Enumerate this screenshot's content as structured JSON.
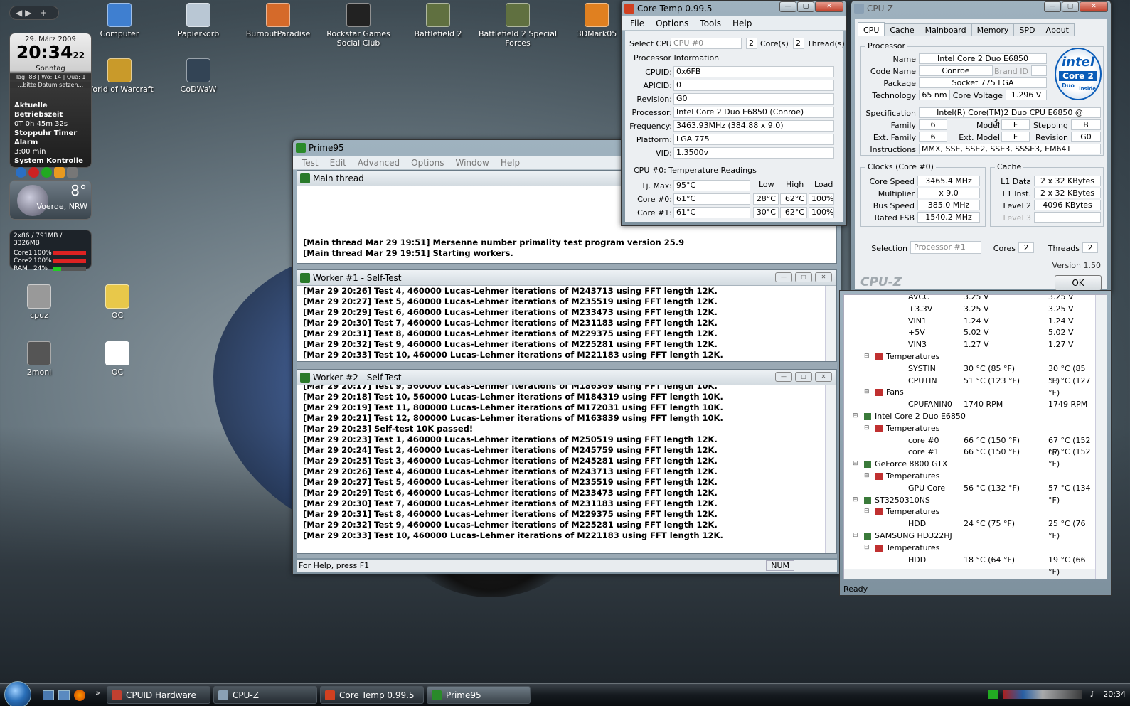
{
  "desktop": {
    "icons": [
      {
        "label": "Computer",
        "color": "#3f7fd0"
      },
      {
        "label": "Papierkorb",
        "color": "#b9c7d4"
      },
      {
        "label": "BurnoutParadise",
        "color": "#d56a2a"
      },
      {
        "label": "Rockstar Games Social Club",
        "color": "#222222"
      },
      {
        "label": "Battlefield 2",
        "color": "#607040"
      },
      {
        "label": "Battlefield 2 Special Forces",
        "color": "#607040"
      },
      {
        "label": "3DMark05",
        "color": "#e08020"
      },
      {
        "label": "World of Warcraft",
        "color": "#c99a2a"
      },
      {
        "label": "CoDWaW",
        "color": "#334455"
      },
      {
        "label": "cpuz",
        "color": "#999999"
      },
      {
        "label": "OC",
        "color": "#e8c84a"
      },
      {
        "label": "2moni",
        "color": "#555555"
      },
      {
        "label": "OC",
        "color": "#ffffff"
      }
    ]
  },
  "gadgets": {
    "clock": {
      "date": "29. März 2009",
      "time": "20:34",
      "seconds": "22",
      "day": "Sonntag",
      "info": "Tag: 88 | Wo: 14 | Qua: 1",
      "note": "...bitte Datum setzen...",
      "uptime_label": "Aktuelle Betriebszeit",
      "uptime": "0T 0h 45m 32s",
      "timer_label": "Stoppuhr Timer Alarm",
      "timer": "3:00 min",
      "control_label": "System Kontrolle"
    },
    "weather": {
      "temp": "8°",
      "location": "Voerde, NRW"
    },
    "meter": {
      "header": "2x86 / 791MB / 3326MB",
      "rows": [
        {
          "name": "Core1",
          "value": "100%",
          "fill": 1.0
        },
        {
          "name": "Core2",
          "value": "100%",
          "fill": 1.0
        },
        {
          "name": "RAM",
          "value": "24%",
          "fill": 0.24
        }
      ]
    }
  },
  "prime95": {
    "title": "Prime95",
    "menu": [
      "Test",
      "Edit",
      "Advanced",
      "Options",
      "Window",
      "Help"
    ],
    "main_thread": {
      "title": "Main thread",
      "lines": [
        "[Main thread Mar 29 19:51] Mersenne number primality test program version 25.9",
        "[Main thread Mar 29 19:51] Starting workers."
      ]
    },
    "worker1": {
      "title": "Worker #1 - Self-Test",
      "lines": [
        "[Mar 29 20:26] Test 4, 460000 Lucas-Lehmer iterations of M243713 using FFT length 12K.",
        "[Mar 29 20:27] Test 5, 460000 Lucas-Lehmer iterations of M235519 using FFT length 12K.",
        "[Mar 29 20:29] Test 6, 460000 Lucas-Lehmer iterations of M233473 using FFT length 12K.",
        "[Mar 29 20:30] Test 7, 460000 Lucas-Lehmer iterations of M231183 using FFT length 12K.",
        "[Mar 29 20:31] Test 8, 460000 Lucas-Lehmer iterations of M229375 using FFT length 12K.",
        "[Mar 29 20:32] Test 9, 460000 Lucas-Lehmer iterations of M225281 using FFT length 12K.",
        "[Mar 29 20:33] Test 10, 460000 Lucas-Lehmer iterations of M221183 using FFT length 12K."
      ]
    },
    "worker2": {
      "title": "Worker #2 - Self-Test",
      "lines": [
        "[Mar 29 20:17] Test 9, 560000 Lucas-Lehmer iterations of M186369 using FFT length 10K.",
        "[Mar 29 20:18] Test 10, 560000 Lucas-Lehmer iterations of M184319 using FFT length 10K.",
        "[Mar 29 20:19] Test 11, 800000 Lucas-Lehmer iterations of M172031 using FFT length 10K.",
        "[Mar 29 20:21] Test 12, 800000 Lucas-Lehmer iterations of M163839 using FFT length 10K.",
        "[Mar 29 20:23] Self-test 10K passed!",
        "[Mar 29 20:23] Test 1, 460000 Lucas-Lehmer iterations of M250519 using FFT length 12K.",
        "[Mar 29 20:24] Test 2, 460000 Lucas-Lehmer iterations of M245759 using FFT length 12K.",
        "[Mar 29 20:25] Test 3, 460000 Lucas-Lehmer iterations of M245281 using FFT length 12K.",
        "[Mar 29 20:26] Test 4, 460000 Lucas-Lehmer iterations of M243713 using FFT length 12K.",
        "[Mar 29 20:27] Test 5, 460000 Lucas-Lehmer iterations of M235519 using FFT length 12K.",
        "[Mar 29 20:29] Test 6, 460000 Lucas-Lehmer iterations of M233473 using FFT length 12K.",
        "[Mar 29 20:30] Test 7, 460000 Lucas-Lehmer iterations of M231183 using FFT length 12K.",
        "[Mar 29 20:31] Test 8, 460000 Lucas-Lehmer iterations of M229375 using FFT length 12K.",
        "[Mar 29 20:32] Test 9, 460000 Lucas-Lehmer iterations of M225281 using FFT length 12K.",
        "[Mar 29 20:33] Test 10, 460000 Lucas-Lehmer iterations of M221183 using FFT length 12K."
      ]
    },
    "status": "For Help, press F1",
    "num": "NUM"
  },
  "coretemp": {
    "title": "Core Temp 0.99.5",
    "menu": [
      "File",
      "Options",
      "Tools",
      "Help"
    ],
    "select_cpu_label": "Select CPU:",
    "select_cpu_value": "CPU #0",
    "cores_count": "2",
    "cores_label": "Core(s)",
    "threads_count": "2",
    "threads_label": "Thread(s)",
    "proc_info_label": "Processor Information",
    "fields": [
      {
        "label": "CPUID:",
        "value": "0x6FB"
      },
      {
        "label": "APICID:",
        "value": "0"
      },
      {
        "label": "Revision:",
        "value": "G0"
      },
      {
        "label": "Processor:",
        "value": "Intel Core 2 Duo E6850 (Conroe)"
      },
      {
        "label": "Frequency:",
        "value": "3463.93MHz (384.88 x 9.0)"
      },
      {
        "label": "Platform:",
        "value": "LGA 775"
      },
      {
        "label": "VID:",
        "value": "1.3500v"
      }
    ],
    "temp_label": "CPU #0: Temperature Readings",
    "col_low": "Low",
    "col_high": "High",
    "col_load": "Load",
    "tjmax_label": "Tj. Max:",
    "tjmax": "95°C",
    "cores": [
      {
        "label": "Core #0:",
        "temp": "61°C",
        "low": "28°C",
        "high": "62°C",
        "load": "100%"
      },
      {
        "label": "Core #1:",
        "temp": "61°C",
        "low": "30°C",
        "high": "62°C",
        "load": "100%"
      }
    ]
  },
  "cpuz": {
    "title": "CPU-Z",
    "tabs": [
      "CPU",
      "Cache",
      "Mainboard",
      "Memory",
      "SPD",
      "About"
    ],
    "processor_label": "Processor",
    "name_label": "Name",
    "name": "Intel Core 2 Duo E6850",
    "codename_label": "Code Name",
    "codename": "Conroe",
    "brandid_label": "Brand ID",
    "package_label": "Package",
    "package": "Socket 775 LGA",
    "tech_label": "Technology",
    "tech": "65 nm",
    "voltage_label": "Core Voltage",
    "voltage": "1.296 V",
    "spec_label": "Specification",
    "spec": "Intel(R) Core(TM)2 Duo CPU     E6850  @ 3.00GHz",
    "family_label": "Family",
    "family": "6",
    "model_label": "Model",
    "model": "F",
    "stepping_label": "Stepping",
    "stepping": "B",
    "extfamily_label": "Ext. Family",
    "extfamily": "6",
    "extmodel_label": "Ext. Model",
    "extmodel": "F",
    "revision_label": "Revision",
    "revision": "G0",
    "instr_label": "Instructions",
    "instr": "MMX, SSE, SSE2, SSE3, SSSE3, EM64T",
    "clocks_label": "Clocks (Core #0)",
    "corespeed_label": "Core Speed",
    "corespeed": "3465.4 MHz",
    "mult_label": "Multiplier",
    "mult": "x 9.0",
    "bus_label": "Bus Speed",
    "bus": "385.0 MHz",
    "fsb_label": "Rated FSB",
    "fsb": "1540.2 MHz",
    "cache_label": "Cache",
    "l1d_label": "L1 Data",
    "l1d": "2 x 32 KBytes",
    "l1i_label": "L1 Inst.",
    "l1i": "2 x 32 KBytes",
    "l2_label": "Level 2",
    "l2": "4096 KBytes",
    "l3_label": "Level 3",
    "selection_label": "Selection",
    "selection": "Processor #1",
    "cores_label": "Cores",
    "cores": "2",
    "threads_label": "Threads",
    "threads": "2",
    "version": "Version 1.50",
    "brand": "CPU-Z",
    "ok": "OK",
    "logo_text": "intel",
    "logo_sub": "Core 2",
    "logo_duo": "Duo",
    "logo_inside": "inside"
  },
  "hwmonitor": {
    "rows": [
      {
        "indent": 3,
        "name": "AVCC",
        "v1": "3.25 V",
        "v2": "3.25 V"
      },
      {
        "indent": 3,
        "name": "+3.3V",
        "v1": "3.25 V",
        "v2": "3.25 V"
      },
      {
        "indent": 3,
        "name": "VIN1",
        "v1": "1.24 V",
        "v2": "1.24 V"
      },
      {
        "indent": 3,
        "name": "+5V",
        "v1": "5.02 V",
        "v2": "5.02 V"
      },
      {
        "indent": 3,
        "name": "VIN3",
        "v1": "1.27 V",
        "v2": "1.27 V"
      },
      {
        "indent": 2,
        "name": "Temperatures",
        "v1": "",
        "v2": ""
      },
      {
        "indent": 3,
        "name": "SYSTIN",
        "v1": "30 °C  (85 °F)",
        "v2": "30 °C  (85 °F)"
      },
      {
        "indent": 3,
        "name": "CPUTIN",
        "v1": "51 °C  (123 °F)",
        "v2": "53 °C  (127 °F)"
      },
      {
        "indent": 2,
        "name": "Fans",
        "v1": "",
        "v2": ""
      },
      {
        "indent": 3,
        "name": "CPUFANIN0",
        "v1": "1740 RPM",
        "v2": "1749 RPM"
      },
      {
        "indent": 1,
        "name": "Intel Core 2 Duo E6850",
        "v1": "",
        "v2": ""
      },
      {
        "indent": 2,
        "name": "Temperatures",
        "v1": "",
        "v2": ""
      },
      {
        "indent": 3,
        "name": "core #0",
        "v1": "66 °C  (150 °F)",
        "v2": "67 °C  (152 °F)"
      },
      {
        "indent": 3,
        "name": "core #1",
        "v1": "66 °C  (150 °F)",
        "v2": "67 °C  (152 °F)"
      },
      {
        "indent": 1,
        "name": "GeForce 8800 GTX",
        "v1": "",
        "v2": ""
      },
      {
        "indent": 2,
        "name": "Temperatures",
        "v1": "",
        "v2": ""
      },
      {
        "indent": 3,
        "name": "GPU Core",
        "v1": "56 °C  (132 °F)",
        "v2": "57 °C  (134 °F)"
      },
      {
        "indent": 1,
        "name": "ST3250310NS",
        "v1": "",
        "v2": ""
      },
      {
        "indent": 2,
        "name": "Temperatures",
        "v1": "",
        "v2": ""
      },
      {
        "indent": 3,
        "name": "HDD",
        "v1": "24 °C  (75 °F)",
        "v2": "25 °C  (76 °F)"
      },
      {
        "indent": 1,
        "name": "SAMSUNG HD322HJ",
        "v1": "",
        "v2": ""
      },
      {
        "indent": 2,
        "name": "Temperatures",
        "v1": "",
        "v2": ""
      },
      {
        "indent": 3,
        "name": "HDD",
        "v1": "18 °C  (64 °F)",
        "v2": "19 °C  (66 °F)"
      }
    ],
    "status": "Ready"
  },
  "taskbar": {
    "buttons": [
      {
        "label": "CPUID Hardware M...",
        "color": "#c04030"
      },
      {
        "label": "CPU-Z",
        "color": "#8aa0b4"
      },
      {
        "label": "Core Temp 0.99.5",
        "color": "#d04020"
      },
      {
        "label": "Prime95",
        "color": "#2a8a2a"
      }
    ],
    "clock": "20:34"
  }
}
